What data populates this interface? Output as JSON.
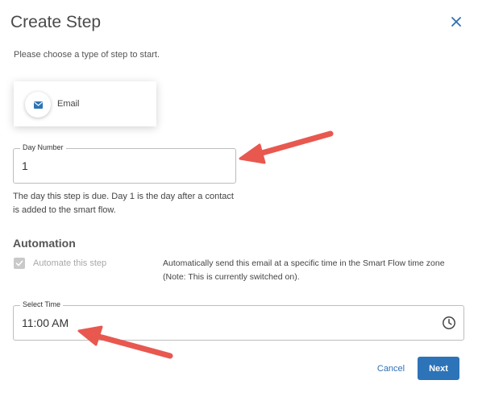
{
  "dialog": {
    "title": "Create Step",
    "intro": "Please choose a type of step to start."
  },
  "step_type": {
    "label": "Email",
    "icon": "envelope-icon"
  },
  "day_number": {
    "legend": "Day Number",
    "value": "1",
    "helper": "The day this step is due. Day 1 is the day after a contact is added to the smart flow."
  },
  "automation": {
    "heading": "Automation",
    "checkbox_label": "Automate this step",
    "checked": true,
    "description": "Automatically send this email at a specific time in the Smart Flow time zone (Note: This is currently switched on)."
  },
  "select_time": {
    "legend": "Select Time",
    "value": "11:00 AM"
  },
  "actions": {
    "cancel": "Cancel",
    "next": "Next"
  },
  "colors": {
    "primary": "#2d73b8",
    "link": "#2f6fb5",
    "annotation_arrow": "#e8584f"
  }
}
